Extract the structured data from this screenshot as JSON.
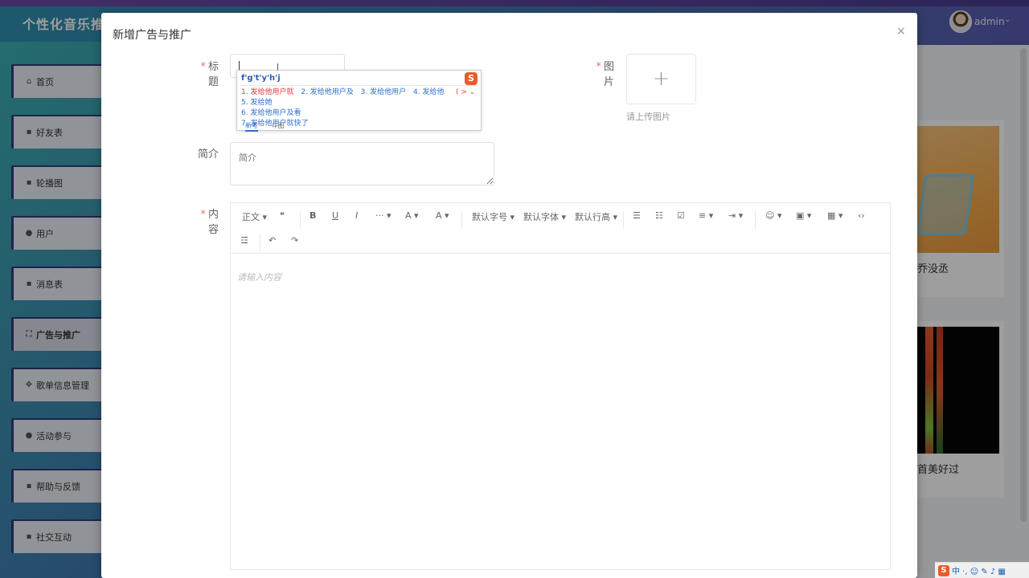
{
  "app": {
    "title": "个性化音乐推荐",
    "user": "admin"
  },
  "sidebar": {
    "items": [
      {
        "label": "首页",
        "icon": "home-icon",
        "glyph": "⌂"
      },
      {
        "label": "好友表",
        "icon": "menu-icon",
        "glyph": "▪"
      },
      {
        "label": "轮播图",
        "icon": "menu-icon",
        "glyph": "▪"
      },
      {
        "label": "用户",
        "icon": "user-icon",
        "glyph": "●"
      },
      {
        "label": "消息表",
        "icon": "menu-icon",
        "glyph": "▪"
      },
      {
        "label": "广告与推广",
        "icon": "crop-icon",
        "glyph": "⛶"
      },
      {
        "label": "歌单信息管理",
        "icon": "grid-icon",
        "glyph": "✥"
      },
      {
        "label": "活动参与",
        "icon": "circle-icon",
        "glyph": "●"
      },
      {
        "label": "帮助与反馈",
        "icon": "menu-icon",
        "glyph": "▪"
      },
      {
        "label": "社交互动",
        "icon": "menu-icon",
        "glyph": "▪"
      }
    ]
  },
  "background_cards": [
    {
      "caption": "乔没丞"
    },
    {
      "caption": "首美好过"
    }
  ],
  "dialog": {
    "title": "新增广告与推广",
    "close": "×",
    "fields": {
      "title_label": "标题",
      "image_label": "图片",
      "image_hint": "请上传图片",
      "image_plus": "+",
      "desc_label": "简介",
      "desc_placeholder": "简介",
      "content_label": "内容",
      "content_placeholder": "请输入内容"
    },
    "required_mark": "*"
  },
  "ime": {
    "pinyin": "f'g't'y'h'j",
    "logo": "S",
    "candidates": [
      "1. 发给他用户就",
      "2. 发给他用户及",
      "3. 发给他用户",
      "4. 发给他",
      "5. 发给她",
      "6. 发给他用户及看",
      "7. 发给他用户就快了"
    ],
    "arrows": "( > ⌄",
    "tabs": [
      "新考",
      "斗图"
    ]
  },
  "toolbar": {
    "paragraph": "正文 ▾",
    "quote": "❝",
    "bold": "B",
    "underline": "U",
    "italic": "I",
    "more": "··· ▾",
    "font_color": "A ▾",
    "bg_color": "A ▾",
    "font_size": "默认字号 ▾",
    "font_family": "默认字体 ▾",
    "line_height": "默认行高 ▾",
    "bullet_list": "☰",
    "numbered_list": "☷",
    "todo": "☑",
    "align": "≡ ▾",
    "indent": "⇥ ▾",
    "emoji": "☺ ▾",
    "image": "▣ ▾",
    "table": "▦ ▾",
    "code": "‹›",
    "divider": "☲",
    "undo": "↶",
    "redo": "↷"
  },
  "tray": {
    "logo": "S",
    "items": "中 ·, ☺ ✎ ♪ ▦"
  }
}
